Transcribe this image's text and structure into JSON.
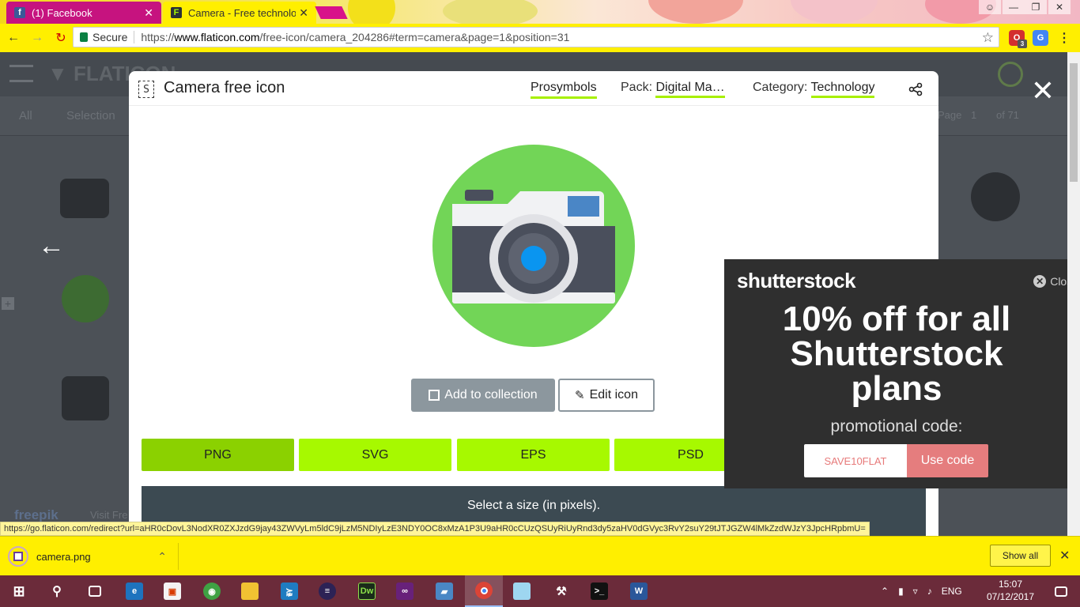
{
  "browser": {
    "tabs": [
      {
        "label": "(1) Facebook",
        "close": "✕"
      },
      {
        "label": "Camera - Free technolog",
        "close": "✕"
      }
    ],
    "secure_label": "Secure",
    "url_prefix": "https://",
    "url_host": "www.flaticon.com",
    "url_path": "/free-icon/camera_204286#term=camera&page=1&position=31",
    "extension_badge": "3"
  },
  "background_page": {
    "filter_all": "All",
    "filter_selection": "Selection",
    "page_label": "Page",
    "page_number": "1",
    "page_total": "of 71",
    "footer_brand": "freepik",
    "footer_visit": "Visit Fre"
  },
  "modal": {
    "badge": "S",
    "title": "Camera free icon",
    "author": "Prosymbols",
    "pack_label": "Pack:",
    "pack_value": "Digital Ma…",
    "category_label": "Category:",
    "category_value": "Technology",
    "add_to_collection": "Add to collection",
    "edit_icon": "Edit icon",
    "formats": [
      "PNG",
      "SVG",
      "EPS",
      "PSD"
    ],
    "size_prompt": "Select a size (in pixels).",
    "colors": {
      "accent": "#a7f900",
      "active_format": "#8bd100",
      "icon_bg": "#72d557"
    }
  },
  "ad": {
    "logo": "shutterstock",
    "close_label": "Close",
    "headline_lines": [
      "10% off for all",
      "Shutterstock",
      "plans"
    ],
    "promo_label": "promotional code:",
    "code": "SAVE10FLAT",
    "use_code": "Use code",
    "colors": {
      "background": "#2f2f2f",
      "cta": "#e57d7e"
    }
  },
  "status_url": "https://go.flaticon.com/redirect?url=aHR0cDovL3NodXR0ZXJzdG9jay43ZWVyLm5ldC9jLzM5NDIyLzE3NDY0OC8xMzA1P3U9aHR0cCUzQSUyRiUyRnd3dy5zaHV0dGVyc3RvY2suY29tJTJGZW4lMkZzdWJzY3JpcHRpbmU=",
  "downloads": {
    "file": "camera.png",
    "show_all": "Show all"
  },
  "taskbar": {
    "language": "ENG",
    "time": "15:07",
    "date": "07/12/2017"
  }
}
